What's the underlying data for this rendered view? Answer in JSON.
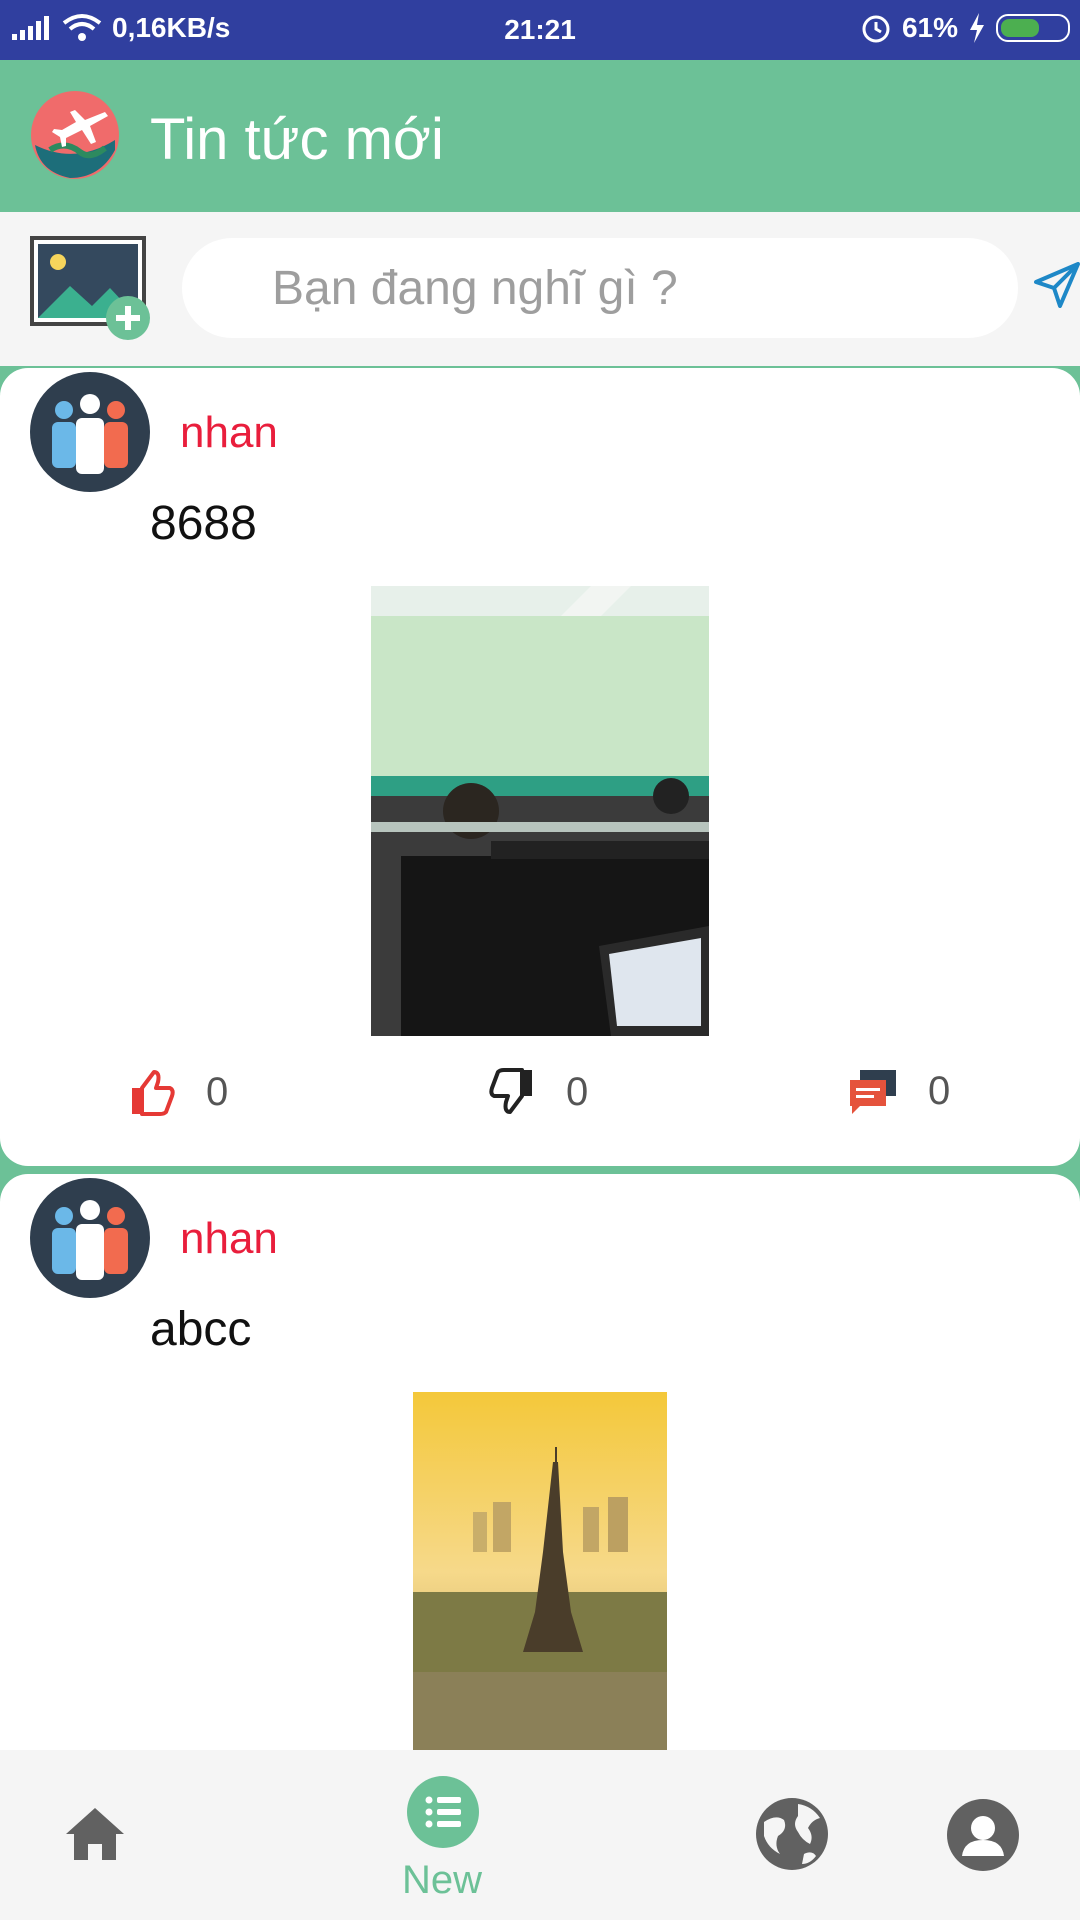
{
  "status_bar": {
    "network_speed": "0,16KB/s",
    "time": "21:21",
    "battery": "61%",
    "battery_level": 0.61
  },
  "app_bar": {
    "title": "Tin tức mới",
    "logo_icon": "airplane-globe-icon"
  },
  "composer": {
    "placeholder": "Bạn đang nghĩ gì ?",
    "add_image_icon": "add-image-icon",
    "send_icon": "send-icon"
  },
  "posts": [
    {
      "user": "nhan",
      "text": "8688",
      "image": "office-photo",
      "likes": "0",
      "dislikes": "0",
      "comments": "0"
    },
    {
      "user": "nhan",
      "text": "abcc",
      "image": "eiffel-tower-photo"
    }
  ],
  "bottom_nav": {
    "items": [
      {
        "icon": "home-icon"
      },
      {
        "icon": "list-icon",
        "label": "New",
        "active": true
      },
      {
        "icon": "globe-icon"
      },
      {
        "icon": "profile-icon"
      }
    ]
  },
  "colors": {
    "primary": "#6cc197",
    "status_bar": "#303f9f",
    "username": "#e91e3c",
    "like": "#e53935"
  }
}
